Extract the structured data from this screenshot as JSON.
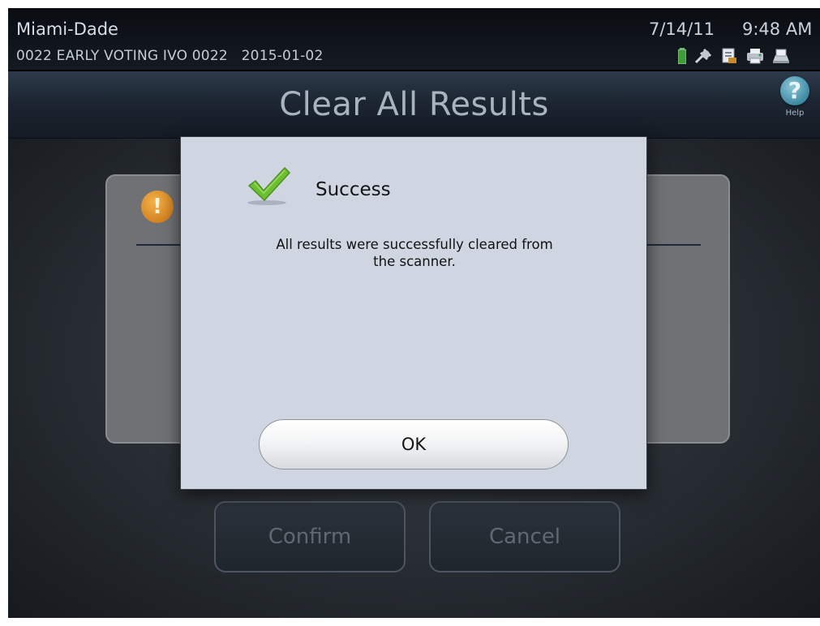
{
  "status_bar": {
    "county": "Miami-Dade",
    "poll_info": "0022 EARLY VOTING IVO 0022   2015-01-02",
    "date": "7/14/11",
    "time": "9:48 AM",
    "icons": [
      "battery-icon",
      "power-plug-icon",
      "document-icon",
      "printer-icon",
      "scanner-icon"
    ]
  },
  "header": {
    "title": "Clear All Results",
    "help_label": "Help",
    "help_glyph": "?"
  },
  "background_panel": {
    "warning_glyph": "!",
    "confirm_label": "Confirm",
    "cancel_label": "Cancel"
  },
  "dialog": {
    "title": "Success",
    "message_line1": "All results were successfully cleared from",
    "message_line2": "the scanner.",
    "ok_label": "OK"
  },
  "colors": {
    "accent_check": "#6cc030",
    "warning": "#e08a1c",
    "help": "#3d8aa4"
  }
}
